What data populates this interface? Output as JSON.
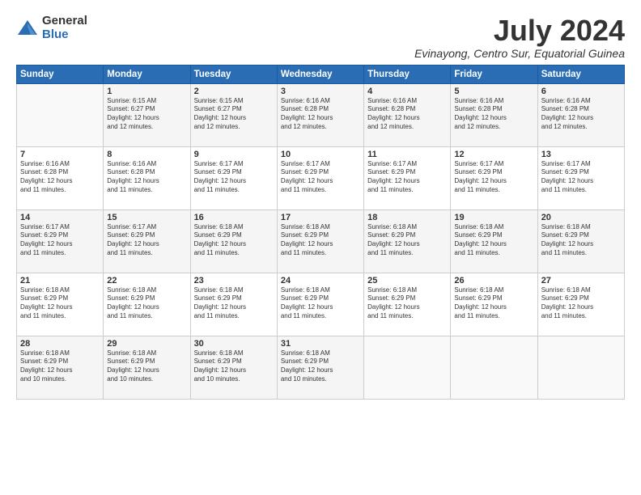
{
  "logo": {
    "general": "General",
    "blue": "Blue"
  },
  "title": "July 2024",
  "subtitle": "Evinayong, Centro Sur, Equatorial Guinea",
  "days_header": [
    "Sunday",
    "Monday",
    "Tuesday",
    "Wednesday",
    "Thursday",
    "Friday",
    "Saturday"
  ],
  "weeks": [
    [
      {
        "day": "",
        "info": ""
      },
      {
        "day": "1",
        "info": "Sunrise: 6:15 AM\nSunset: 6:27 PM\nDaylight: 12 hours\nand 12 minutes."
      },
      {
        "day": "2",
        "info": "Sunrise: 6:15 AM\nSunset: 6:27 PM\nDaylight: 12 hours\nand 12 minutes."
      },
      {
        "day": "3",
        "info": "Sunrise: 6:16 AM\nSunset: 6:28 PM\nDaylight: 12 hours\nand 12 minutes."
      },
      {
        "day": "4",
        "info": "Sunrise: 6:16 AM\nSunset: 6:28 PM\nDaylight: 12 hours\nand 12 minutes."
      },
      {
        "day": "5",
        "info": "Sunrise: 6:16 AM\nSunset: 6:28 PM\nDaylight: 12 hours\nand 12 minutes."
      },
      {
        "day": "6",
        "info": "Sunrise: 6:16 AM\nSunset: 6:28 PM\nDaylight: 12 hours\nand 12 minutes."
      }
    ],
    [
      {
        "day": "7",
        "info": "Sunrise: 6:16 AM\nSunset: 6:28 PM\nDaylight: 12 hours\nand 11 minutes."
      },
      {
        "day": "8",
        "info": "Sunrise: 6:16 AM\nSunset: 6:28 PM\nDaylight: 12 hours\nand 11 minutes."
      },
      {
        "day": "9",
        "info": "Sunrise: 6:17 AM\nSunset: 6:29 PM\nDaylight: 12 hours\nand 11 minutes."
      },
      {
        "day": "10",
        "info": "Sunrise: 6:17 AM\nSunset: 6:29 PM\nDaylight: 12 hours\nand 11 minutes."
      },
      {
        "day": "11",
        "info": "Sunrise: 6:17 AM\nSunset: 6:29 PM\nDaylight: 12 hours\nand 11 minutes."
      },
      {
        "day": "12",
        "info": "Sunrise: 6:17 AM\nSunset: 6:29 PM\nDaylight: 12 hours\nand 11 minutes."
      },
      {
        "day": "13",
        "info": "Sunrise: 6:17 AM\nSunset: 6:29 PM\nDaylight: 12 hours\nand 11 minutes."
      }
    ],
    [
      {
        "day": "14",
        "info": "Sunrise: 6:17 AM\nSunset: 6:29 PM\nDaylight: 12 hours\nand 11 minutes."
      },
      {
        "day": "15",
        "info": "Sunrise: 6:17 AM\nSunset: 6:29 PM\nDaylight: 12 hours\nand 11 minutes."
      },
      {
        "day": "16",
        "info": "Sunrise: 6:18 AM\nSunset: 6:29 PM\nDaylight: 12 hours\nand 11 minutes."
      },
      {
        "day": "17",
        "info": "Sunrise: 6:18 AM\nSunset: 6:29 PM\nDaylight: 12 hours\nand 11 minutes."
      },
      {
        "day": "18",
        "info": "Sunrise: 6:18 AM\nSunset: 6:29 PM\nDaylight: 12 hours\nand 11 minutes."
      },
      {
        "day": "19",
        "info": "Sunrise: 6:18 AM\nSunset: 6:29 PM\nDaylight: 12 hours\nand 11 minutes."
      },
      {
        "day": "20",
        "info": "Sunrise: 6:18 AM\nSunset: 6:29 PM\nDaylight: 12 hours\nand 11 minutes."
      }
    ],
    [
      {
        "day": "21",
        "info": "Sunrise: 6:18 AM\nSunset: 6:29 PM\nDaylight: 12 hours\nand 11 minutes."
      },
      {
        "day": "22",
        "info": "Sunrise: 6:18 AM\nSunset: 6:29 PM\nDaylight: 12 hours\nand 11 minutes."
      },
      {
        "day": "23",
        "info": "Sunrise: 6:18 AM\nSunset: 6:29 PM\nDaylight: 12 hours\nand 11 minutes."
      },
      {
        "day": "24",
        "info": "Sunrise: 6:18 AM\nSunset: 6:29 PM\nDaylight: 12 hours\nand 11 minutes."
      },
      {
        "day": "25",
        "info": "Sunrise: 6:18 AM\nSunset: 6:29 PM\nDaylight: 12 hours\nand 11 minutes."
      },
      {
        "day": "26",
        "info": "Sunrise: 6:18 AM\nSunset: 6:29 PM\nDaylight: 12 hours\nand 11 minutes."
      },
      {
        "day": "27",
        "info": "Sunrise: 6:18 AM\nSunset: 6:29 PM\nDaylight: 12 hours\nand 11 minutes."
      }
    ],
    [
      {
        "day": "28",
        "info": "Sunrise: 6:18 AM\nSunset: 6:29 PM\nDaylight: 12 hours\nand 10 minutes."
      },
      {
        "day": "29",
        "info": "Sunrise: 6:18 AM\nSunset: 6:29 PM\nDaylight: 12 hours\nand 10 minutes."
      },
      {
        "day": "30",
        "info": "Sunrise: 6:18 AM\nSunset: 6:29 PM\nDaylight: 12 hours\nand 10 minutes."
      },
      {
        "day": "31",
        "info": "Sunrise: 6:18 AM\nSunset: 6:29 PM\nDaylight: 12 hours\nand 10 minutes."
      },
      {
        "day": "",
        "info": ""
      },
      {
        "day": "",
        "info": ""
      },
      {
        "day": "",
        "info": ""
      }
    ]
  ]
}
